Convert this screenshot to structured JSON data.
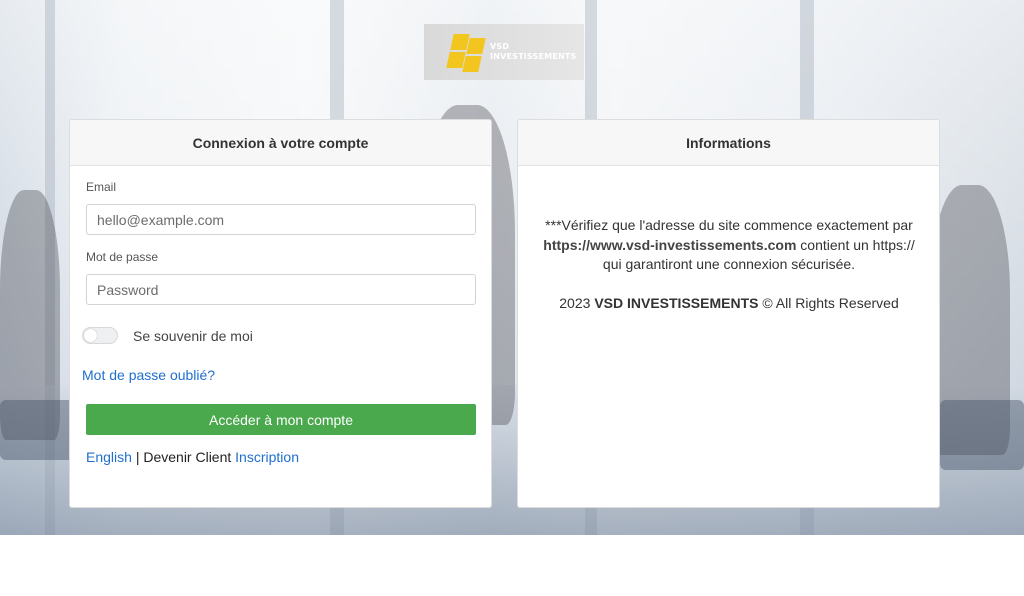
{
  "logo": {
    "line1": "VSD",
    "line2": "INVESTISSEMENTS",
    "mark_color": "#f2c61f"
  },
  "login": {
    "title": "Connexion à votre compte",
    "email_label": "Email",
    "email_placeholder": "hello@example.com",
    "email_value": "",
    "password_label": "Mot de passe",
    "password_placeholder": "Password",
    "password_value": "",
    "remember_label": "Se souvenir de moi",
    "remember_checked": false,
    "forgot_link": "Mot de passe oublié?",
    "submit_label": "Accéder à mon compte",
    "submit_color": "#4aa84d",
    "footer": {
      "english_link": "English",
      "separator": "|",
      "client_text": "Devenir Client",
      "signup_link": "Inscription"
    }
  },
  "info": {
    "title": "Informations",
    "warning_prefix": "***Vérifiez que l'adresse du site commence exactement par ",
    "warning_url": "https://www.vsd-investissements.com",
    "warning_suffix": " contient un https:// qui garantiront une connexion sécurisée.",
    "copyright_year": "2023 ",
    "copyright_company": "VSD INVESTISSEMENTS",
    "copyright_suffix": " © All Rights Reserved"
  },
  "colors": {
    "link": "#1f6fcf",
    "header_bg": "#f7f7f7",
    "button": "#4aa84d"
  }
}
